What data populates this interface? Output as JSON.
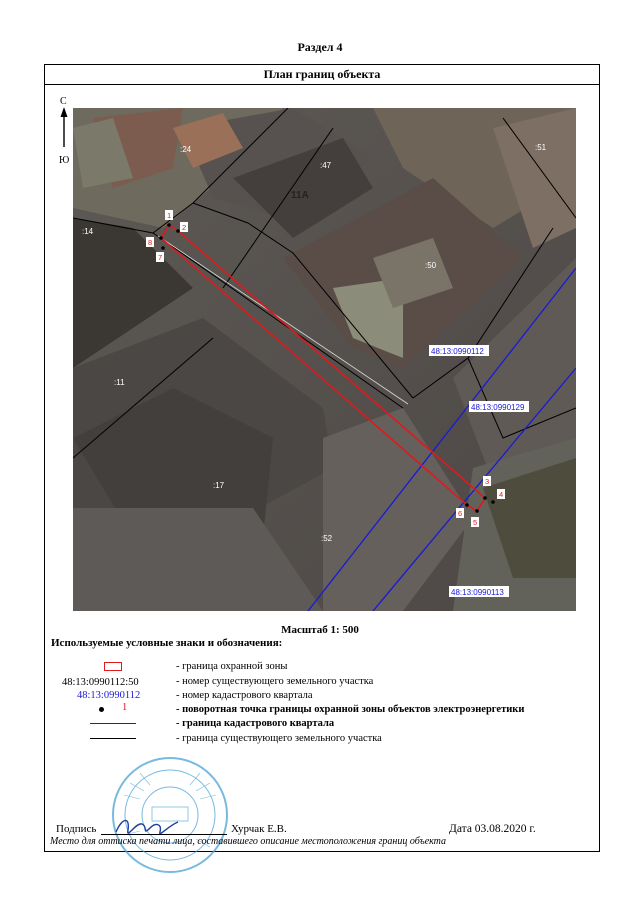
{
  "section_title": "Раздел 4",
  "plan_title": "План границ объекта",
  "compass": {
    "north": "С",
    "south": "Ю"
  },
  "map": {
    "parcel_labels": [
      ":24",
      ":47",
      "11А",
      ":51",
      ":14",
      ":50",
      ":11",
      ":17",
      ":52"
    ],
    "quarter_labels": [
      "48:13:0990112",
      "48:13:0990129",
      "48:13:0990113"
    ],
    "point_labels": [
      "1",
      "2",
      "8",
      "7",
      "3",
      "4",
      "6",
      "5"
    ],
    "colors": {
      "zone": "#e0191d",
      "quarter": "#1a1ad6",
      "parcel": "#000000"
    }
  },
  "scale": "Масштаб 1: 500",
  "legend": {
    "title": "Используемые условные знаки и обозначения:",
    "items": [
      {
        "symbol": "",
        "text": "- граница  охранной зоны"
      },
      {
        "symbol": "48:13:0990112:50",
        "text": "- номер существующего земельного участка"
      },
      {
        "symbol": "48:13:0990112",
        "text": "- номер кадастрового квартала"
      },
      {
        "symbol": "1",
        "text": "- поворотная точка границы охранной зоны объектов электроэнергетики"
      },
      {
        "symbol": "",
        "text": "- граница кадастрового квартала"
      },
      {
        "symbol": "",
        "text": "- граница существующего земельного участка"
      }
    ]
  },
  "signature": {
    "label": "Подпись",
    "name": "Хурчак Е.В.",
    "date": "Дата 03.08.2020 г.",
    "note": "Место для оттиска печати лица, составившего описание местоположения границ объекта"
  },
  "stamp_text": "Липецкая обл., Добринский р-н, п.Добринка, Кадастровый инженер, 126-562-681 91, Юрчак Вячеслав"
}
